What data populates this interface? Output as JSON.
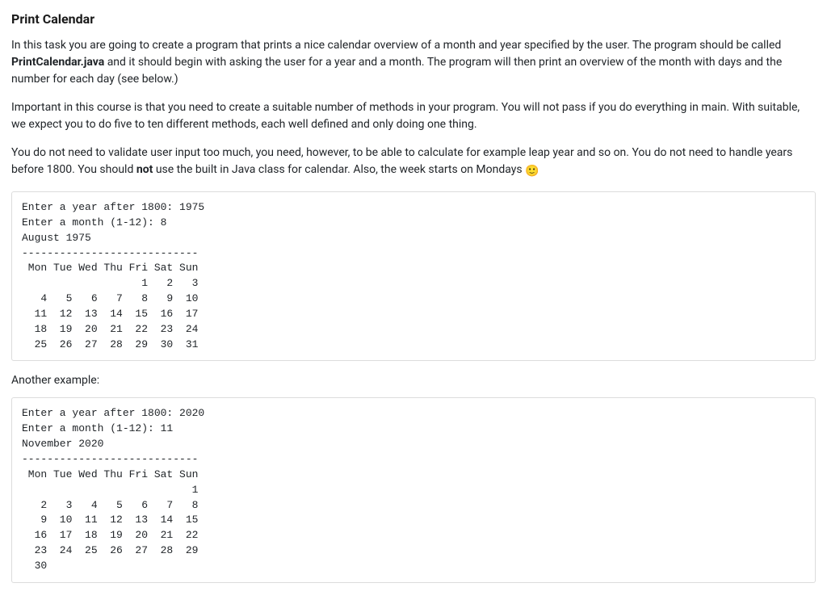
{
  "title": "Print Calendar",
  "para1_pre": "In this task you are going to create a program that prints a nice calendar overview of a month and year specified by the user. The program should be called ",
  "para1_strong": "PrintCalendar.java",
  "para1_post": " and it should begin with asking the user for a year and a month. The program will then print an overview of the month with days and the number for each day (see below.)",
  "para2": "Important in this course is that you need to create a suitable number of methods in your program. You will not pass if you do everything in main. With suitable, we expect you to do five to ten different methods, each well defined and only doing one thing.",
  "para3_pre": "You do not need to validate user input too much, you need, however, to be able to calculate for example leap year and so on. You do not need to handle years before 1800. You should ",
  "para3_strong": "not",
  "para3_post": " use the built in Java class for calendar. Also, the week starts on Mondays ",
  "emoji": "🙂",
  "code1": "Enter a year after 1800: 1975\nEnter a month (1-12): 8\nAugust 1975\n----------------------------\n Mon Tue Wed Thu Fri Sat Sun\n                   1   2   3\n   4   5   6   7   8   9  10\n  11  12  13  14  15  16  17\n  18  19  20  21  22  23  24\n  25  26  27  28  29  30  31",
  "example_label": "Another example:",
  "code2": "Enter a year after 1800: 2020\nEnter a month (1-12): 11\nNovember 2020\n----------------------------\n Mon Tue Wed Thu Fri Sat Sun\n                           1\n   2   3   4   5   6   7   8\n   9  10  11  12  13  14  15\n  16  17  18  19  20  21  22\n  23  24  25  26  27  28  29\n  30"
}
